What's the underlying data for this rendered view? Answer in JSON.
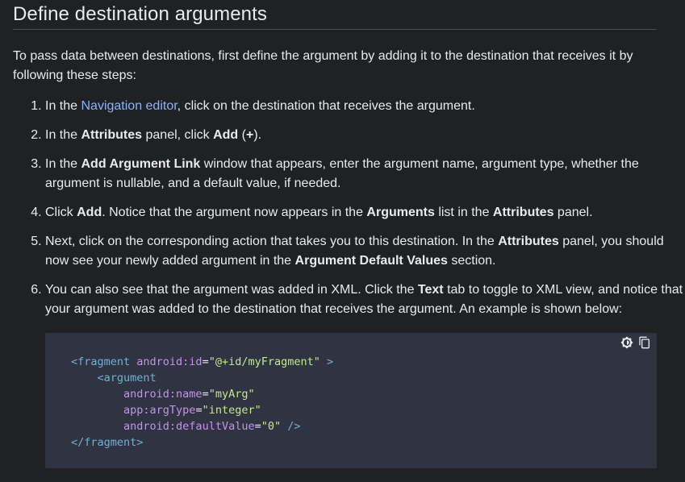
{
  "page": {
    "title": "Define destination arguments",
    "intro": "To pass data between destinations, first define the argument by adding it to the destination that receives it by following these steps:"
  },
  "steps": [
    {
      "pre": "In the ",
      "link": "Navigation editor",
      "post": ", click on the destination that receives the argument."
    },
    {
      "t1": "In the ",
      "b1": "Attributes",
      "t2": " panel, click ",
      "b2": "Add",
      "t3": " (",
      "b3": "+",
      "t4": ")."
    },
    {
      "t1": "In the ",
      "b1": "Add Argument Link",
      "t2": " window that appears, enter the argument name, argument type, whether the argument is nullable, and a default value, if needed."
    },
    {
      "t1": "Click ",
      "b1": "Add",
      "t2": ". Notice that the argument now appears in the ",
      "b2": "Arguments",
      "t3": " list in the ",
      "b3": "Attributes",
      "t4": " panel."
    },
    {
      "t1": "Next, click on the corresponding action that takes you to this destination. In the ",
      "b1": "Attributes",
      "t2": " panel, you should now see your newly added argument in the ",
      "b2": "Argument Default Values",
      "t3": " section."
    },
    {
      "t1": "You can also see that the argument was added in XML. Click the ",
      "b1": "Text",
      "t2": " tab to toggle to XML view, and notice that your argument was added to the destination that receives the argument. An example is shown below:"
    }
  ],
  "code": {
    "line1": {
      "open": "<fragment ",
      "attr": "android:id",
      "eq": "=",
      "val": "\"@+id/myFragment\"",
      "close": " >"
    },
    "line2": {
      "indent": "    ",
      "open": "<argument"
    },
    "line3": {
      "indent": "        ",
      "attr": "android:name",
      "eq": "=",
      "val": "\"myArg\""
    },
    "line4": {
      "indent": "        ",
      "attr": "app:argType",
      "eq": "=",
      "val": "\"integer\""
    },
    "line5": {
      "indent": "        ",
      "attr": "android:defaultValue",
      "eq": "=",
      "val": "\"0\"",
      "close": " />"
    },
    "line6": {
      "close": "</fragment>"
    }
  },
  "icons": {
    "theme_toggle": "brightness-icon",
    "copy": "copy-icon"
  },
  "colors": {
    "background": "#202124",
    "text": "#e8eaed",
    "link": "#8ab4f8",
    "code_background": "#2f3342",
    "code_tag": "#6fb3d2",
    "code_attr": "#c792ea",
    "code_string": "#c3e88d"
  }
}
